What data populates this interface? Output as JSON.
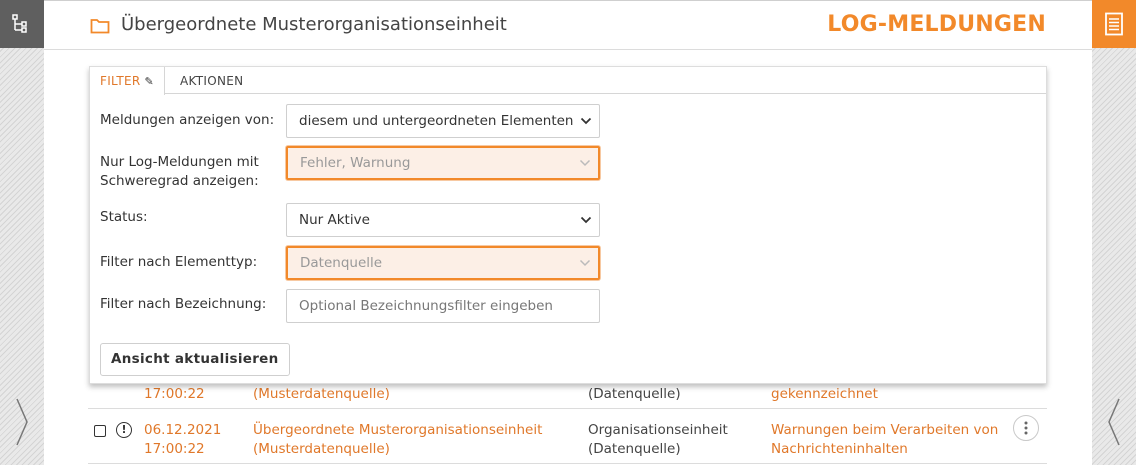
{
  "header": {
    "title": "Übergeordnete Musterorganisationseinheit",
    "section": "LOG-MELDUNGEN"
  },
  "filter": {
    "tabs": [
      {
        "label": "FILTER"
      },
      {
        "label": "AKTIONEN"
      }
    ],
    "fields": [
      {
        "label": "Meldungen anzeigen von:",
        "value": "diesem und untergeordneten Elementen"
      },
      {
        "label_line1": "Nur Log-Meldungen mit",
        "label_line2": "Schweregrad anzeigen:",
        "value": "Fehler, Warnung"
      },
      {
        "label": "Status:",
        "value": "Nur Aktive"
      },
      {
        "label": "Filter nach Elementtyp:",
        "value": "Datenquelle"
      },
      {
        "label": "Filter nach Bezeichnung:",
        "placeholder": "Optional Bezeichnungsfilter eingeben"
      }
    ],
    "refresh_label": "Ansicht aktualisieren"
  },
  "rows": [
    {
      "time": "17:00:22",
      "source": "(Musterdatenquelle)",
      "type": "(Datenquelle)",
      "message": "gekennzeichnet"
    },
    {
      "date": "06.12.2021",
      "time": "17:00:22",
      "source_line1": "Übergeordnete Musterorganisationseinheit",
      "source_line2": "(Musterdatenquelle)",
      "type_line1": "Organisationseinheit",
      "type_line2": "(Datenquelle)",
      "message_line1": "Warnungen beim Verarbeiten von",
      "message_line2": "Nachrichteninhalten"
    }
  ],
  "icons": {
    "left_rail": "tree-structure-icon",
    "right_rail": "log-document-icon",
    "header": "folder-icon",
    "row_status": "warning-icon",
    "row_menu": "more-vertical-icon",
    "nav_left": "chevron-right-icon",
    "nav_right": "chevron-left-icon"
  },
  "colors": {
    "accent": "#f2892a",
    "accent_text": "#e0782a",
    "left_rail_button": "#5f5f5f"
  }
}
